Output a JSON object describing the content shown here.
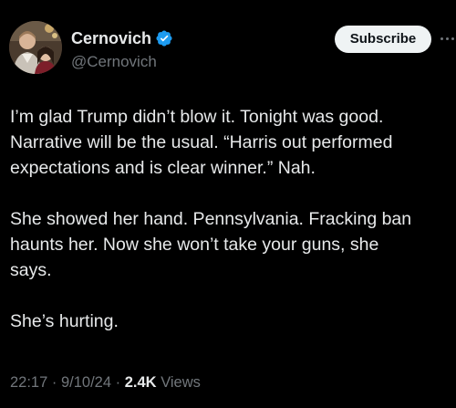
{
  "author": {
    "display_name": "Cernovich",
    "handle": "@Cernovich",
    "verified": true
  },
  "actions": {
    "subscribe_label": "Subscribe"
  },
  "tweet": {
    "paragraphs": [
      [
        "I’m glad Trump didn’t blow it. Tonight was good.",
        "Narrative will be the usual. “Harris out performed",
        "expectations and is clear winner.” Nah."
      ],
      [
        "She showed her hand. Pennsylvania. Fracking  ban",
        "haunts her. Now she won’t take your guns, she",
        "says."
      ],
      [
        "She’s hurting."
      ]
    ]
  },
  "meta": {
    "time": "22:17",
    "separator": "·",
    "date": "9/10/24",
    "views_count": "2.4K",
    "views_label": "Views"
  },
  "colors": {
    "background": "#000000",
    "text_primary": "#e7e9ea",
    "text_secondary": "#71767b",
    "verified_badge": "#1d9bf0",
    "subscribe_bg": "#eff3f4"
  },
  "icons": [
    "verified-badge-icon",
    "more-options-icon"
  ]
}
